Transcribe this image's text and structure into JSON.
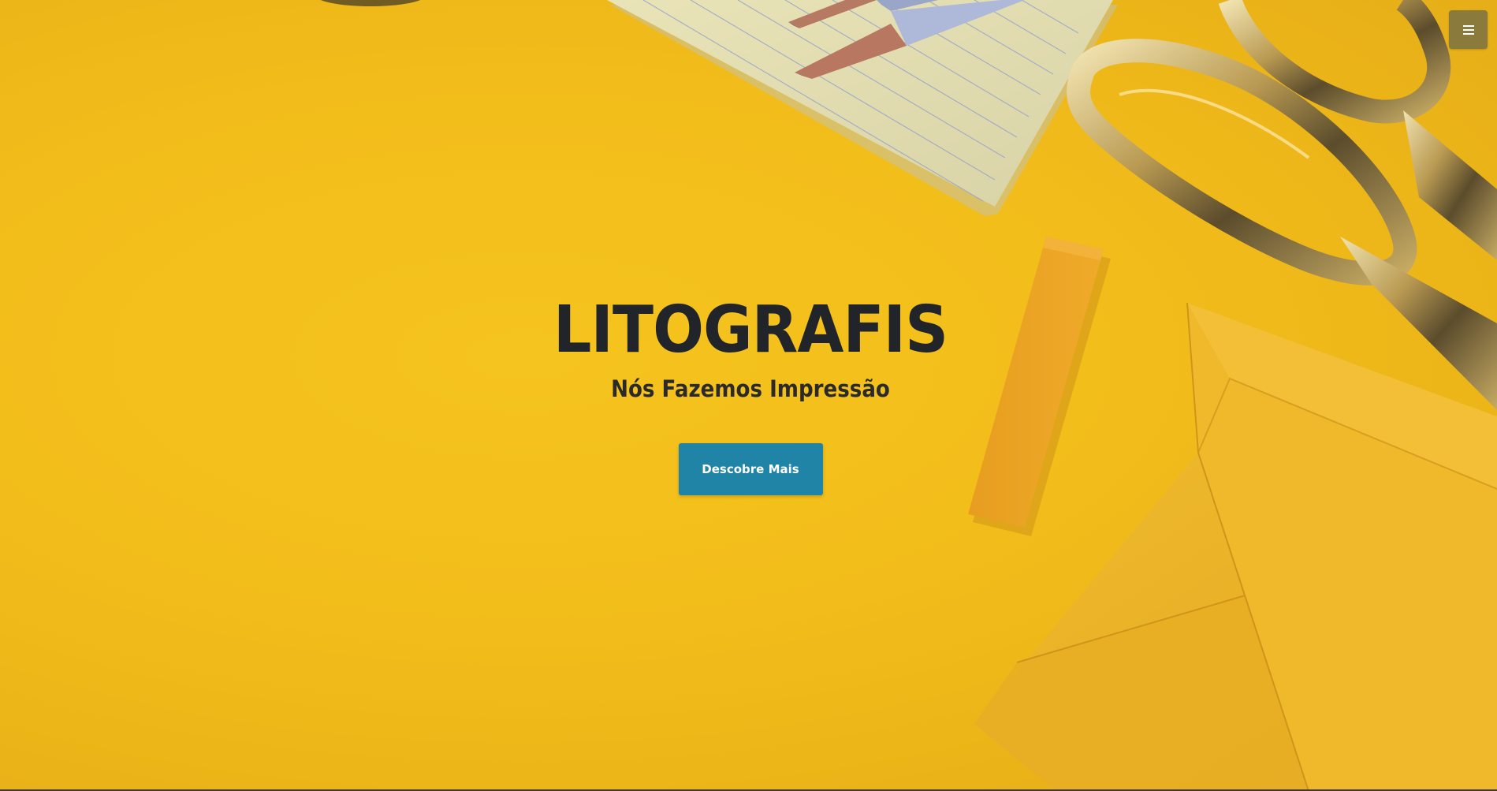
{
  "brand": {
    "title": "LITOGRAFIS",
    "tagline": "Nós Fazemos Impressão"
  },
  "cta": {
    "label": "Descobre Mais"
  },
  "nav": {
    "menu_icon": "hamburger-menu-icon"
  },
  "colors": {
    "background": "#f2bd1a",
    "button": "#1f84a6",
    "menu_button": "#8a7a3c",
    "heading_text": "#212529"
  }
}
